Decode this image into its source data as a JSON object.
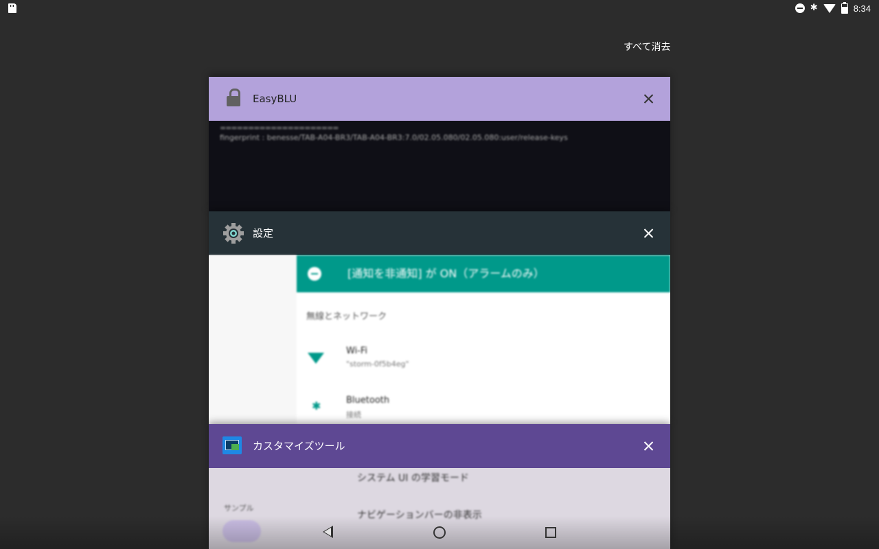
{
  "status_bar": {
    "time": "8:34",
    "left_icons": [
      "sd-card-icon"
    ],
    "right_icons": [
      "do-not-disturb-icon",
      "bluetooth-icon",
      "wifi-icon",
      "battery-icon"
    ]
  },
  "recents": {
    "clear_all_label": "すべて消去"
  },
  "cards": [
    {
      "title": "EasyBLU",
      "icon": "lock-icon",
      "header_color": "#b3a2db",
      "preview": {
        "line1": "=====================",
        "line2": "fingerprint : benesse/TAB-A04-BR3/TAB-A04-BR3:7.0/02.05.080/02.05.080:user/release-keys"
      }
    },
    {
      "title": "設定",
      "icon": "gear-icon",
      "header_color": "#263238",
      "preview": {
        "banner": "[通知を非通知] が ON（アラームのみ）",
        "section": "無線とネットワーク",
        "wifi_title": "Wi-Fi",
        "wifi_sub": "\"storm-0f5b4eg\"",
        "bt_title": "Bluetooth",
        "bt_sub": "接続"
      }
    },
    {
      "title": "カスタマイズツール",
      "icon": "customization-tool-icon",
      "header_color": "#5e4893",
      "preview": {
        "row1": "システム UI の学習モード",
        "sample": "サンプル",
        "row2": "ナビゲーションバーの非表示"
      }
    }
  ],
  "nav": {
    "buttons": [
      "back-icon",
      "home-icon",
      "recents-icon"
    ]
  }
}
